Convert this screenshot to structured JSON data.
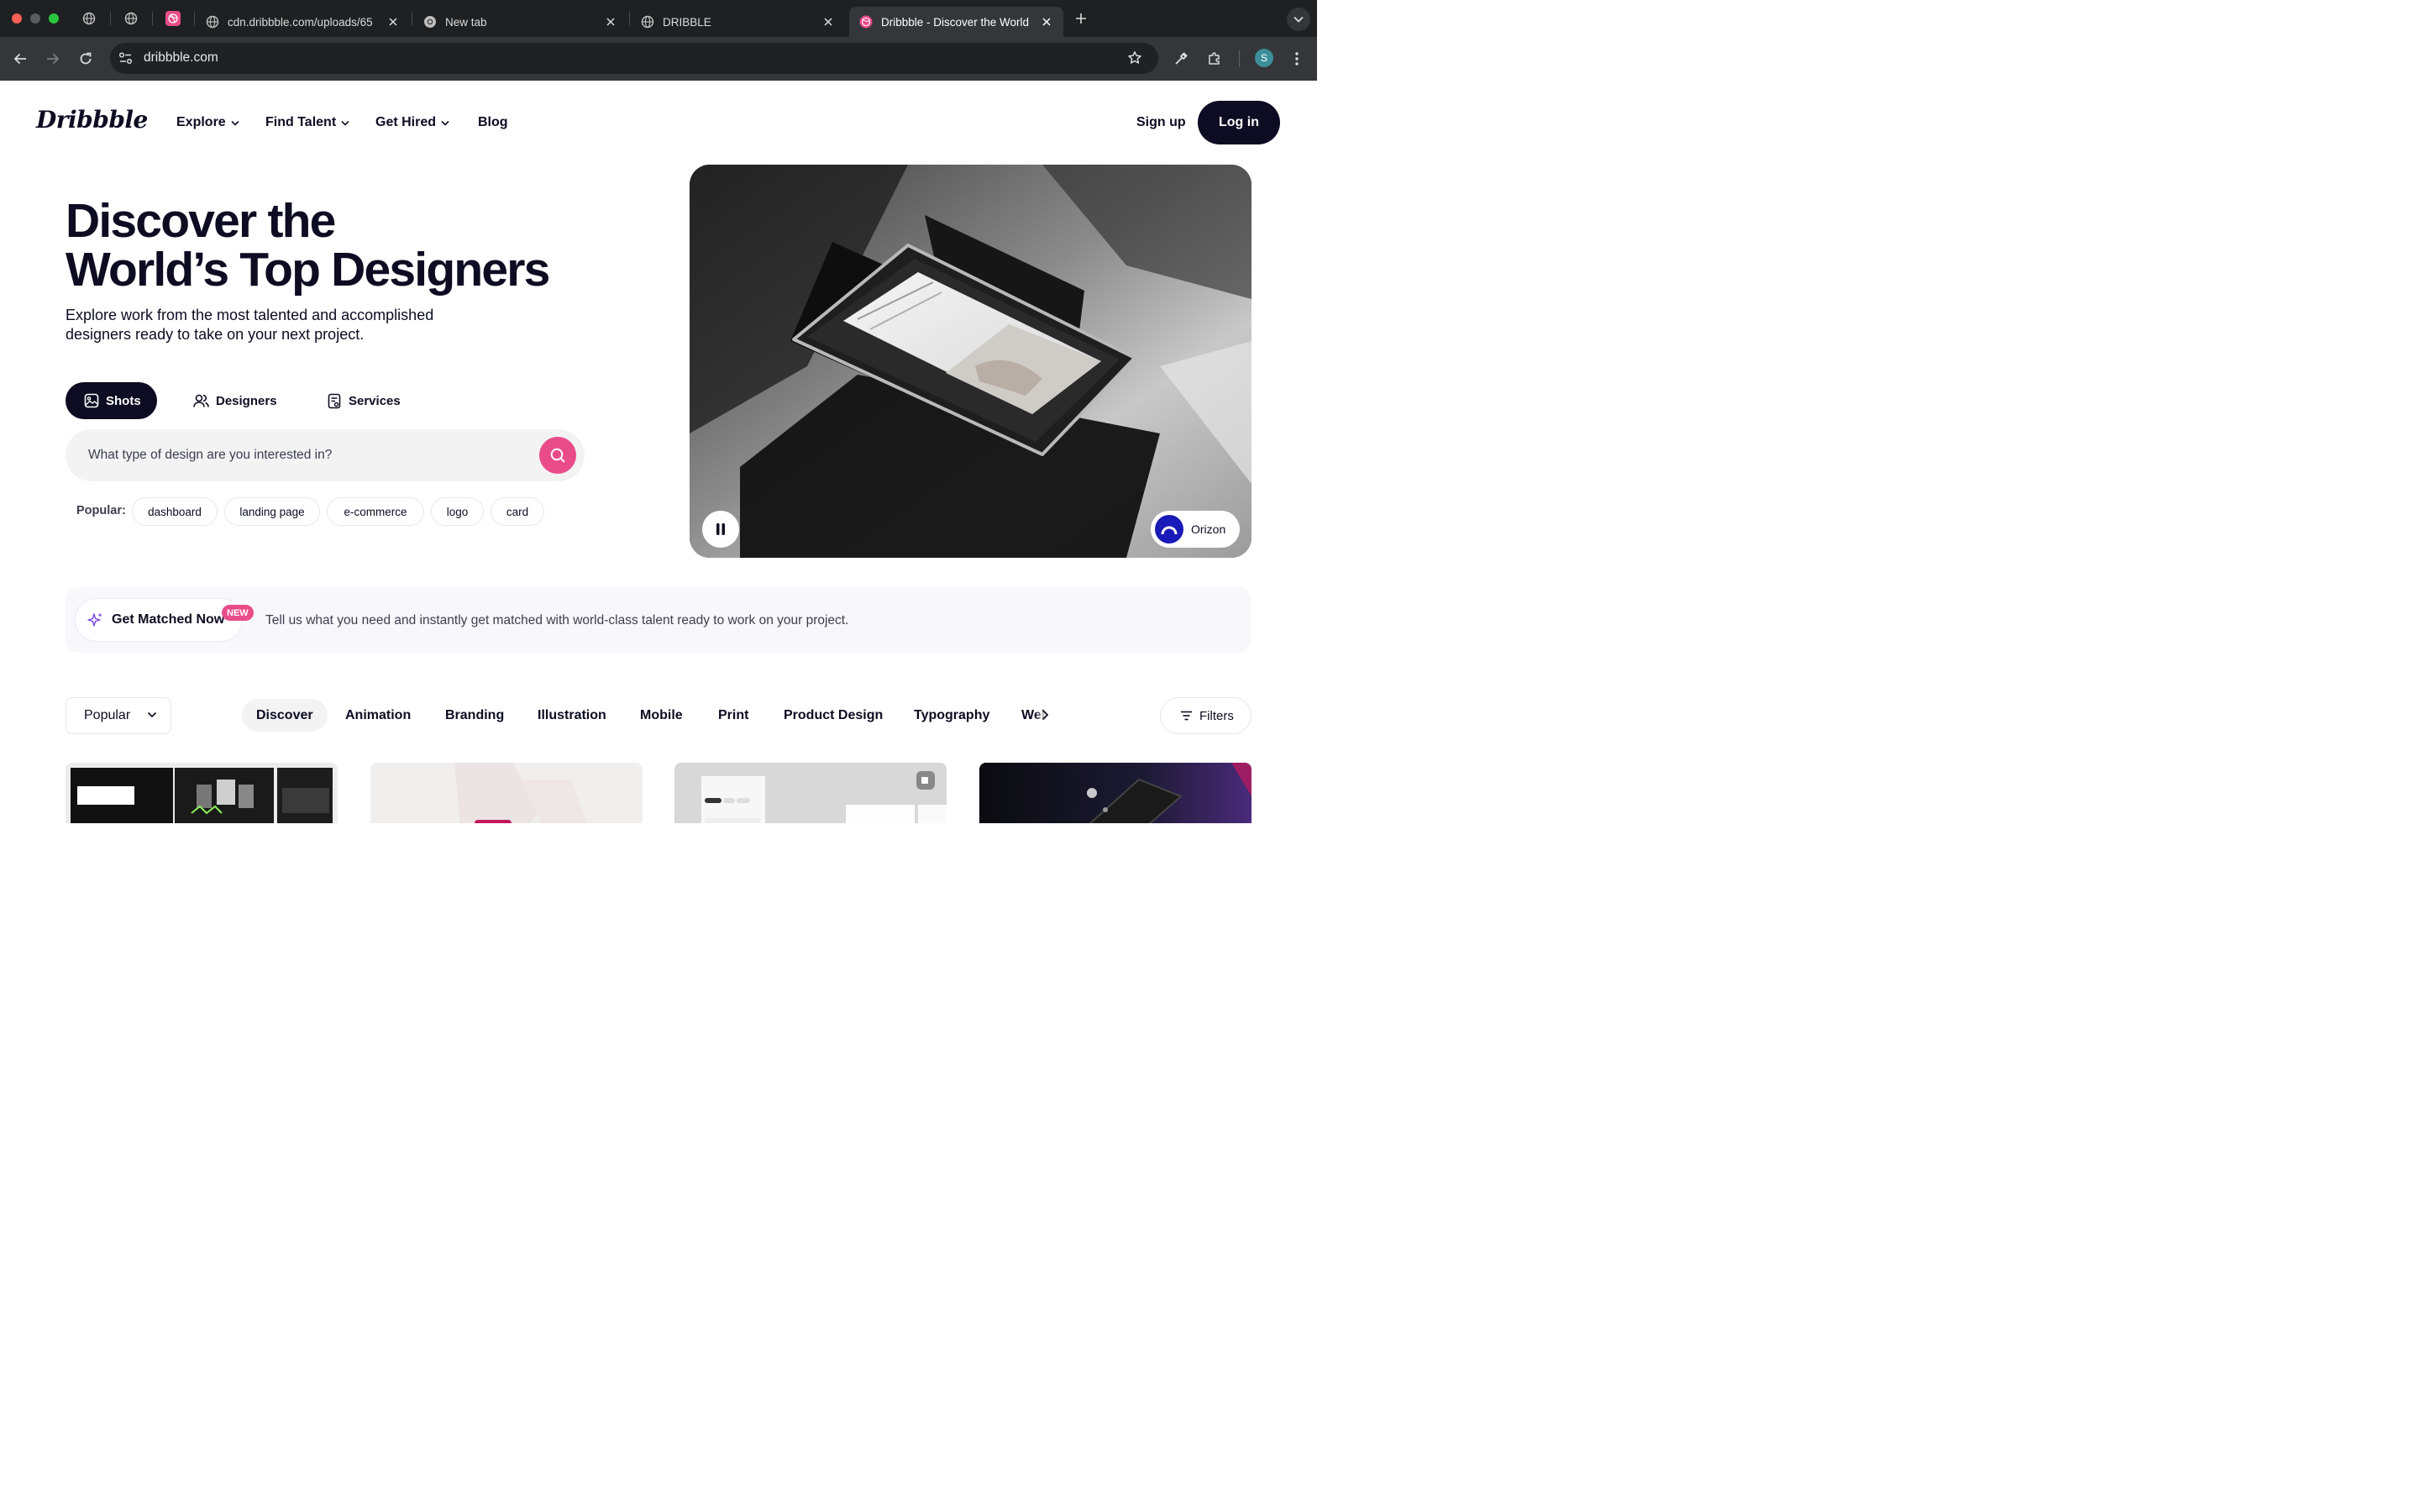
{
  "browser": {
    "tabs": [
      {
        "title": "cdn.dribbble.com/uploads/65"
      },
      {
        "title": "New tab"
      },
      {
        "title": "DRIBBLE"
      },
      {
        "title": "Dribbble - Discover the World"
      }
    ],
    "url": "dribbble.com",
    "profile_initial": "S"
  },
  "header": {
    "logo": "Dribbble",
    "nav": [
      {
        "label": "Explore"
      },
      {
        "label": "Find Talent"
      },
      {
        "label": "Get Hired"
      },
      {
        "label": "Blog"
      }
    ],
    "signup_label": "Sign up",
    "login_label": "Log in"
  },
  "hero": {
    "title_lines": [
      "Discover the",
      "World’s Top Designers"
    ],
    "subtitle_lines": [
      "Explore work from the most talented and accomplished",
      "designers ready to take on your next project."
    ],
    "segments": [
      {
        "label": "Shots",
        "active": true
      },
      {
        "label": "Designers",
        "active": false
      },
      {
        "label": "Services",
        "active": false
      }
    ],
    "search_placeholder": "What type of design are you interested in?",
    "popular_label": "Popular:",
    "popular_tags": [
      "dashboard",
      "landing page",
      "e-commerce",
      "logo",
      "card"
    ],
    "media_credit": "Orizon"
  },
  "banner": {
    "cta_label": "Get Matched Now",
    "badge": "NEW",
    "text": "Tell us what you need and instantly get matched with world-class talent ready to work on your project."
  },
  "filters_bar": {
    "sort_selected": "Popular",
    "categories": [
      "Discover",
      "Animation",
      "Branding",
      "Illustration",
      "Mobile",
      "Print",
      "Product Design",
      "Typography",
      "Web"
    ],
    "active_category": "Discover",
    "filters_label": "Filters"
  },
  "colors": {
    "brand_pink": "#ea4c89",
    "ink": "#0d0c22"
  }
}
